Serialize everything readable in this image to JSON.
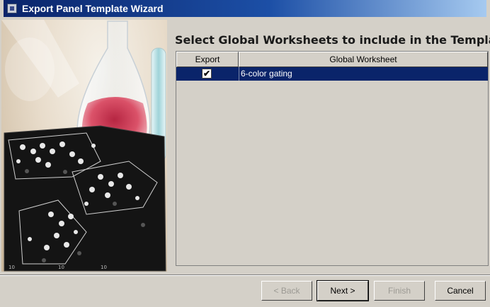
{
  "window": {
    "title": "Export Panel Template Wizard"
  },
  "heading": "Select Global Worksheets to include in the Template",
  "table": {
    "columns": [
      "Export",
      "Global Worksheet"
    ],
    "rows": [
      {
        "export": true,
        "worksheet": "6-color gating",
        "selected": true
      }
    ]
  },
  "buttons": {
    "back": "< Back",
    "next": "Next >",
    "finish": "Finish",
    "cancel": "Cancel"
  },
  "colors": {
    "selection": "#0a246a",
    "titlebar": "#0a246a",
    "face": "#d4d0c8"
  }
}
